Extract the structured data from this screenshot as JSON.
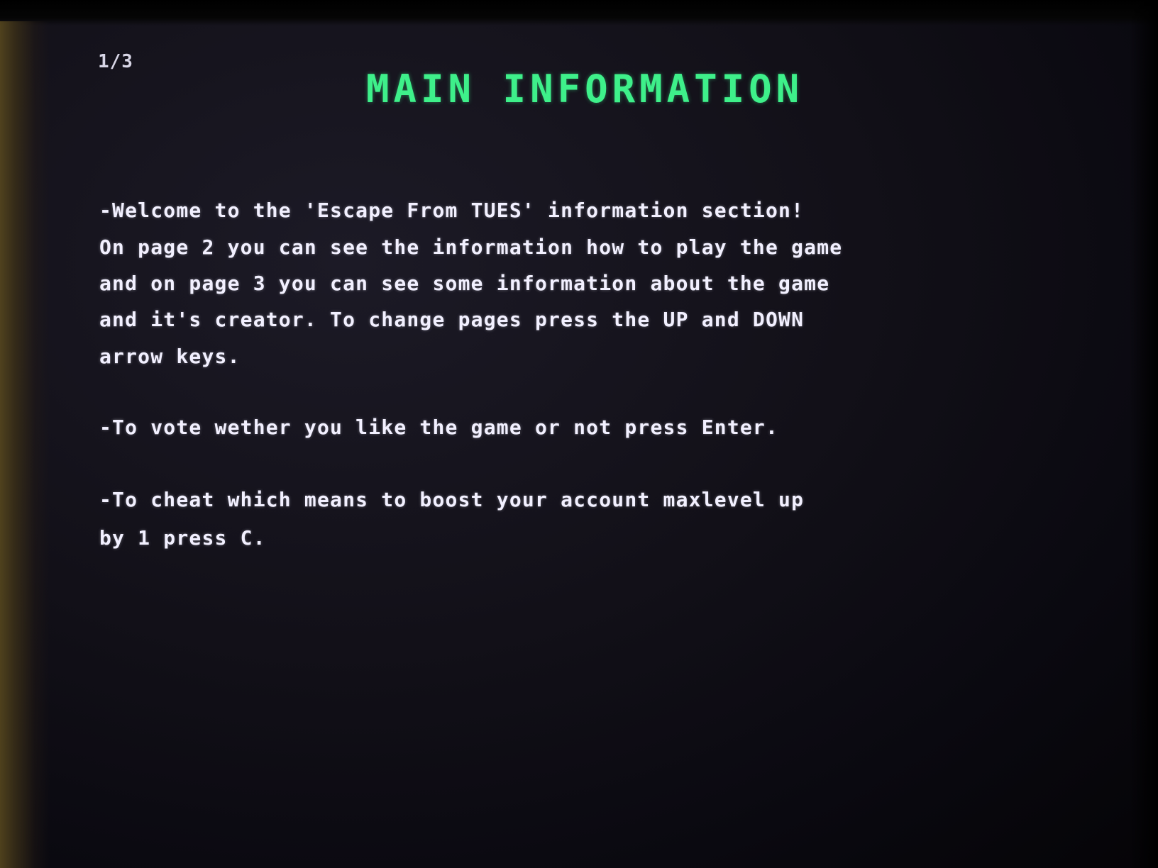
{
  "page_indicator": "1/3",
  "title": "MAIN INFORMATION",
  "paragraphs": [
    {
      "lines": [
        "-Welcome to the 'Escape From TUES' information section!",
        "On page 2 you can see the information how to play the game",
        "and on page 3 you can see some information about the game",
        "and it's creator. To change pages press the UP and DOWN",
        "arrow keys."
      ]
    },
    {
      "lines": [
        "-To vote wether you like the game or not press Enter."
      ]
    },
    {
      "lines": [
        "-To cheat which means to boost your account maxlevel up",
        "by 1 press C."
      ]
    }
  ],
  "colors": {
    "title": "#3ef08a",
    "text": "#f2f0ff",
    "background": "#121018"
  }
}
